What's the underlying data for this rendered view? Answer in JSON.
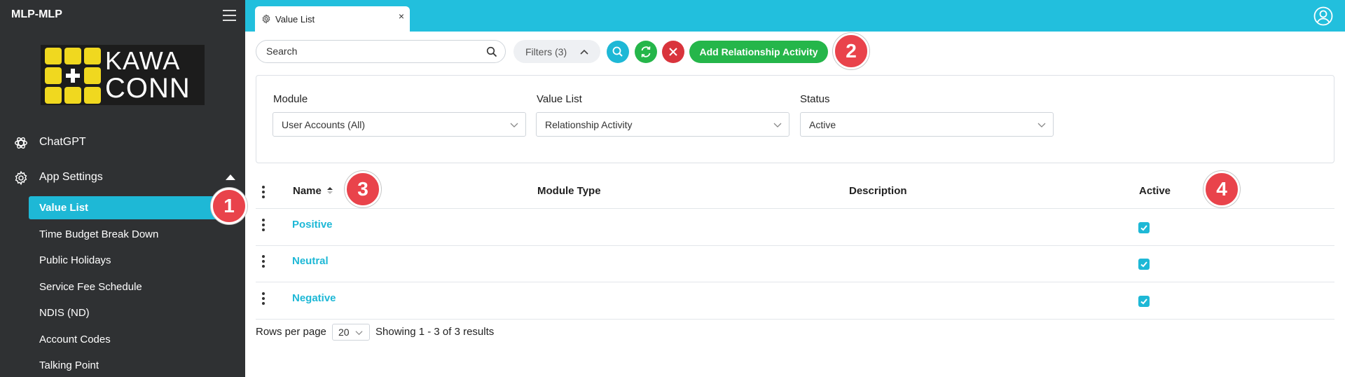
{
  "app": {
    "title": "MLP-MLP",
    "logo_text_top": "KAWA",
    "logo_text_bottom": "CONN"
  },
  "sidebar": {
    "items": [
      {
        "label": "ChatGPT",
        "icon": "chatgpt-icon"
      },
      {
        "label": "App Settings",
        "icon": "gear-icon",
        "expanded": true
      }
    ],
    "sub_items": [
      {
        "label": "Value List",
        "active": true
      },
      {
        "label": "Time Budget Break Down"
      },
      {
        "label": "Public Holidays"
      },
      {
        "label": "Service Fee Schedule"
      },
      {
        "label": "NDIS (ND)"
      },
      {
        "label": "Account Codes"
      },
      {
        "label": "Talking Point"
      }
    ]
  },
  "tabs": [
    {
      "label": "Value List",
      "icon": "gear-icon",
      "close": "×"
    }
  ],
  "toolbar": {
    "search_placeholder": "Search",
    "filters_label": "Filters (3)",
    "add_label": "Add Relationship Activity"
  },
  "filters": [
    {
      "label": "Module",
      "value": "User Accounts (All)"
    },
    {
      "label": "Value List",
      "value": "Relationship Activity"
    },
    {
      "label": "Status",
      "value": "Active"
    }
  ],
  "table": {
    "columns": [
      "Name",
      "Module Type",
      "Description",
      "Active"
    ],
    "rows": [
      {
        "name": "Positive",
        "module_type": "",
        "description": "",
        "active": true
      },
      {
        "name": "Neutral",
        "module_type": "",
        "description": "",
        "active": true
      },
      {
        "name": "Negative",
        "module_type": "",
        "description": "",
        "active": true
      }
    ]
  },
  "pagination": {
    "rows_label": "Rows per page",
    "rows_value": "20",
    "results_text": "Showing 1 - 3 of 3 results"
  },
  "annotations": [
    "1",
    "2",
    "3",
    "4"
  ],
  "colors": {
    "accent": "#1eb8d6",
    "sidebar": "#2f3133",
    "add_button": "#25b64a",
    "badge": "#e9434b",
    "delete_button": "#d9343c"
  }
}
